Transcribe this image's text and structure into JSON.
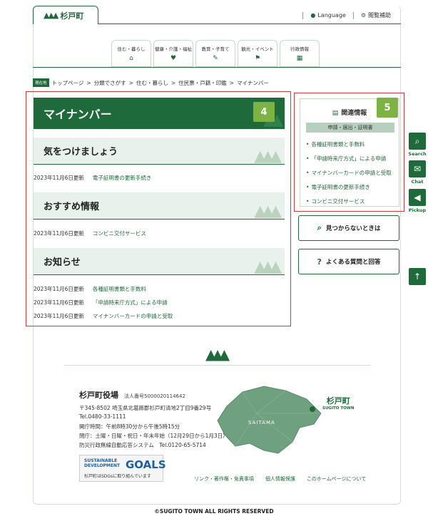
{
  "header": {
    "logo_icon": "tree-icon",
    "logo_text": "杉戸町",
    "language": "Language",
    "accessibility": "閲覧補助"
  },
  "gnav": [
    {
      "label": "住む・暮らし",
      "icon": "house-icon"
    },
    {
      "label": "健康・介護・福祉",
      "icon": "heart-hand-icon"
    },
    {
      "label": "教育・子育て",
      "icon": "note-pen-icon"
    },
    {
      "label": "観光・イベント",
      "icon": "flag-icon"
    },
    {
      "label": "行政情報",
      "icon": "building-icon"
    }
  ],
  "breadcrumb": {
    "here": "現在地",
    "items": [
      "トップページ",
      "分類でさがす",
      "住む・暮らし",
      "住民票・戸籍・印鑑",
      "マイナンバー"
    ]
  },
  "page": {
    "title": "マイナンバー",
    "badge4": "4",
    "badge5": "5"
  },
  "sections": [
    {
      "heading": "気をつけましょう",
      "rows": [
        {
          "date": "2023年11月6日更新",
          "link": "電子証明書の更新手続き"
        }
      ]
    },
    {
      "heading": "おすすめ情報",
      "rows": [
        {
          "date": "2023年11月6日更新",
          "link": "コンビニ交付サービス"
        }
      ]
    },
    {
      "heading": "お知らせ",
      "rows": [
        {
          "date": "2023年11月6日更新",
          "link": "各種証明書類と手数料"
        },
        {
          "date": "2023年11月6日更新",
          "link": "「申請時来庁方式」による申請"
        },
        {
          "date": "2023年11月6日更新",
          "link": "マイナンバーカードの申請と受取"
        }
      ]
    }
  ],
  "related": {
    "heading": "関連情報",
    "category": "申請・届出・証明書",
    "items": [
      "各種証明書類と手数料",
      "「申請時来庁方式」による申請",
      "マイナンバーカードの申請と受取",
      "電子証明書の更新手続き",
      "コンビニ交付サービス"
    ]
  },
  "side_buttons": [
    {
      "label": "見つからないときは",
      "icon": "search-doc-icon"
    },
    {
      "label": "よくある質問と回答",
      "icon": "question-bubble-icon"
    }
  ],
  "float": {
    "search": "Search",
    "chat": "Chat",
    "pickup": "Pickup"
  },
  "footer": {
    "office": "杉戸町役場",
    "corp_no": "法人番号5000020114642",
    "address": "〒345-8502 埼玉県北葛飾郡杉戸町清地2丁目9番29号",
    "tel": "Tel.0480-33-1111",
    "hours": "開庁時間：午前8時30分から午後5時15分",
    "closed": "閉庁：土曜・日曜・祝日・年末年始（12月29日から1月3日）",
    "disaster": "防災行政無線自動応答システム　Tel.0120-65-5714",
    "map_label": "SAITAMA",
    "brand": "杉戸町",
    "brand_en": "SUGITO TOWN",
    "sdg_line1": "SUSTAINABLE",
    "sdg_line2": "DEVELOPMENT",
    "sdg_goals": "GOALS",
    "sdg_sub": "杉戸町はSDGsに取り組んでいます",
    "links": [
      "リンク・著作権・免責事項",
      "個人情報保護",
      "このホームページについて"
    ],
    "copyright": "©SUGITO TOWN ALL RIGHTS RESERVED"
  }
}
